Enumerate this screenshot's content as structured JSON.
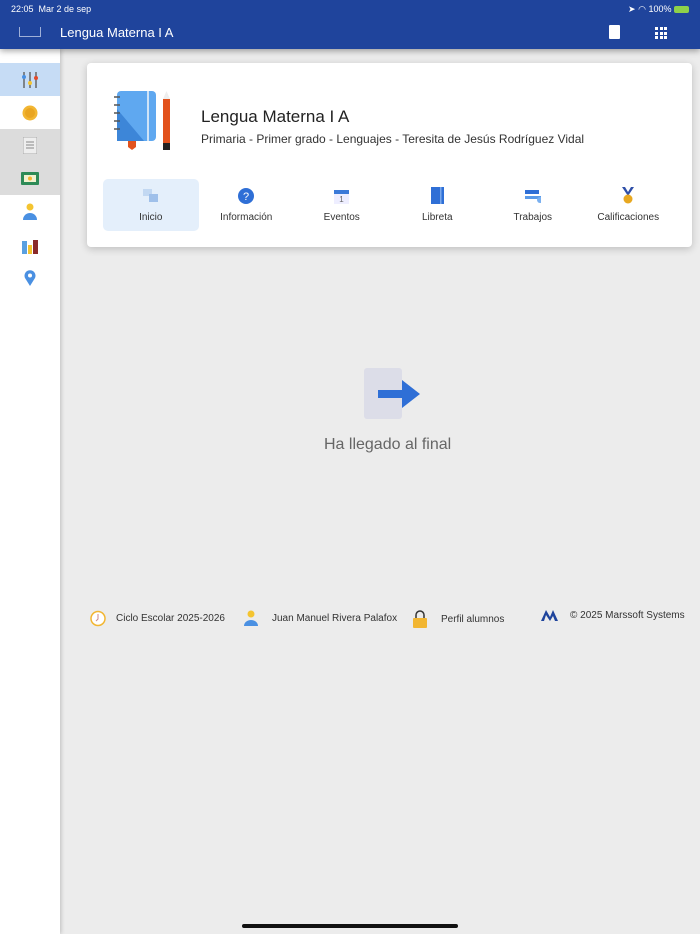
{
  "status": {
    "time": "22:05",
    "date": "Mar 2 de sep",
    "battery": "100%"
  },
  "header": {
    "title": "Lengua Materna I A"
  },
  "sidebar": {
    "items": [
      "filters",
      "coins",
      "receipt",
      "money",
      "student",
      "family",
      "location"
    ]
  },
  "course": {
    "title": "Lengua Materna I A",
    "subtitle": "Primaria - Primer grado - Lenguajes - Teresita de Jesús Rodríguez Vidal"
  },
  "tabs": [
    {
      "label": "Inicio"
    },
    {
      "label": "Información"
    },
    {
      "label": "Eventos"
    },
    {
      "label": "Libreta"
    },
    {
      "label": "Trabajos"
    },
    {
      "label": "Calificaciones"
    }
  ],
  "main": {
    "end_message": "Ha llegado al final"
  },
  "footer": {
    "cycle": "Ciclo Escolar 2025-2026",
    "user": "Juan Manuel Rivera Palafox",
    "profile": "Perfil alumnos",
    "copyright": "© 2025 Marssoft Systems"
  }
}
